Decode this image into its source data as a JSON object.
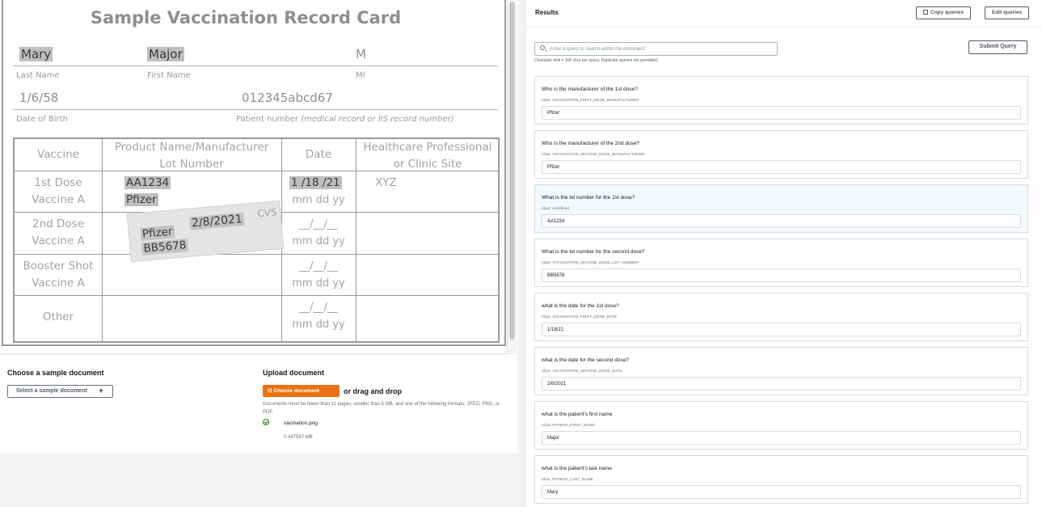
{
  "card": {
    "title": "Sample Vaccination Record Card",
    "last_name_value": "Mary",
    "first_name_value": "Major",
    "mi_value": "M",
    "last_name_label": "Last Name",
    "first_name_label": "First Name",
    "mi_label": "MI",
    "dob_value": "1/6/58",
    "patient_number_value": "012345abcd67",
    "dob_label": "Date of Birth",
    "patient_number_label": "Patient number",
    "patient_number_hint": "(medical record or IIS record number)",
    "table": {
      "header_vaccine": "Vaccine",
      "header_product_1": "Product Name/Manufacturer",
      "header_product_2": "Lot Number",
      "header_date": "Date",
      "header_site_1": "Healthcare Professional",
      "header_site_2": "or Clinic Site",
      "row1_label_1": "1st Dose",
      "row1_label_2": "Vaccine A",
      "row1_lot": "AA1234",
      "row1_manufacturer": "Pfizer",
      "row1_date": "1 /18 /21",
      "row1_site": "XYZ",
      "row2_label_1": "2nd Dose",
      "row2_label_2": "Vaccine A",
      "row3_label_1": "Booster Shot",
      "row3_label_2": "Vaccine A",
      "row4_label": "Other",
      "date_blank": "__/__/__",
      "date_format": "mm dd yy",
      "sticker_manufacturer": "Pfizer",
      "sticker_lot": "BB5678",
      "sticker_date": "2/8/2021",
      "sticker_site": "CVS"
    }
  },
  "upload": {
    "sample_title": "Choose a sample document",
    "sample_select": "Select a sample document",
    "upload_title": "Upload document",
    "choose_button": "Choose document",
    "drag_text": "or drag and drop",
    "help_text": "Documents must be fewer than 11 pages, smaller than 5 MB, and one of the following formats: JPEG, PNG, or PDF.",
    "file_name": "vacination.png",
    "file_size": "0.447567 MB"
  },
  "results": {
    "title": "Results",
    "copy_button": "Copy queries",
    "edit_button": "Edit queries",
    "search_placeholder": "Enter a query to search within the document",
    "char_limit": "Character limit = 200 char per query; Duplicate queries not permitted.",
    "submit_button": "Submit Query",
    "queries": [
      {
        "question": "Who is the manufacturer of the 1st dose?",
        "alias": "Alias: VACCINATION_FIRST_DOSE_MANUFACTURER",
        "answer": "Pfizer"
      },
      {
        "question": "Who is the manufacturer of the 2nd dose?",
        "alias": "Alias: VACCINATION_SECOND_DOSE_MANUFACTURER",
        "answer": "Pfizer"
      },
      {
        "question": "What is the lot number for the 1st dose?",
        "alias": "Alias: undefined",
        "answer": "AA1234"
      },
      {
        "question": "What is the lot number for the second dose?",
        "alias": "Alias: VACCINATION_SECOND_DOSE_LOT_NUMBER",
        "answer": "BB5678"
      },
      {
        "question": "what is the date for the 1st dose?",
        "alias": "Alias: VACCINATION_FIRST_DOSE_DATE",
        "answer": "1/18/21"
      },
      {
        "question": "what is the date for the second dose?",
        "alias": "Alias: VACCINATION_SECOND_DOSE_DATE",
        "answer": "2/8/2021"
      },
      {
        "question": "what is the patient's first name",
        "alias": "Alias: PATIENT_FIRST_NAME",
        "answer": "Major"
      },
      {
        "question": "what is the patient's last name",
        "alias": "Alias: PATIENT_LAST_NAME",
        "answer": "Mary"
      }
    ]
  },
  "colors": {
    "accent_orange": "#ec7211",
    "success_green": "#1d8102",
    "selected_bg": "#f1faff"
  }
}
